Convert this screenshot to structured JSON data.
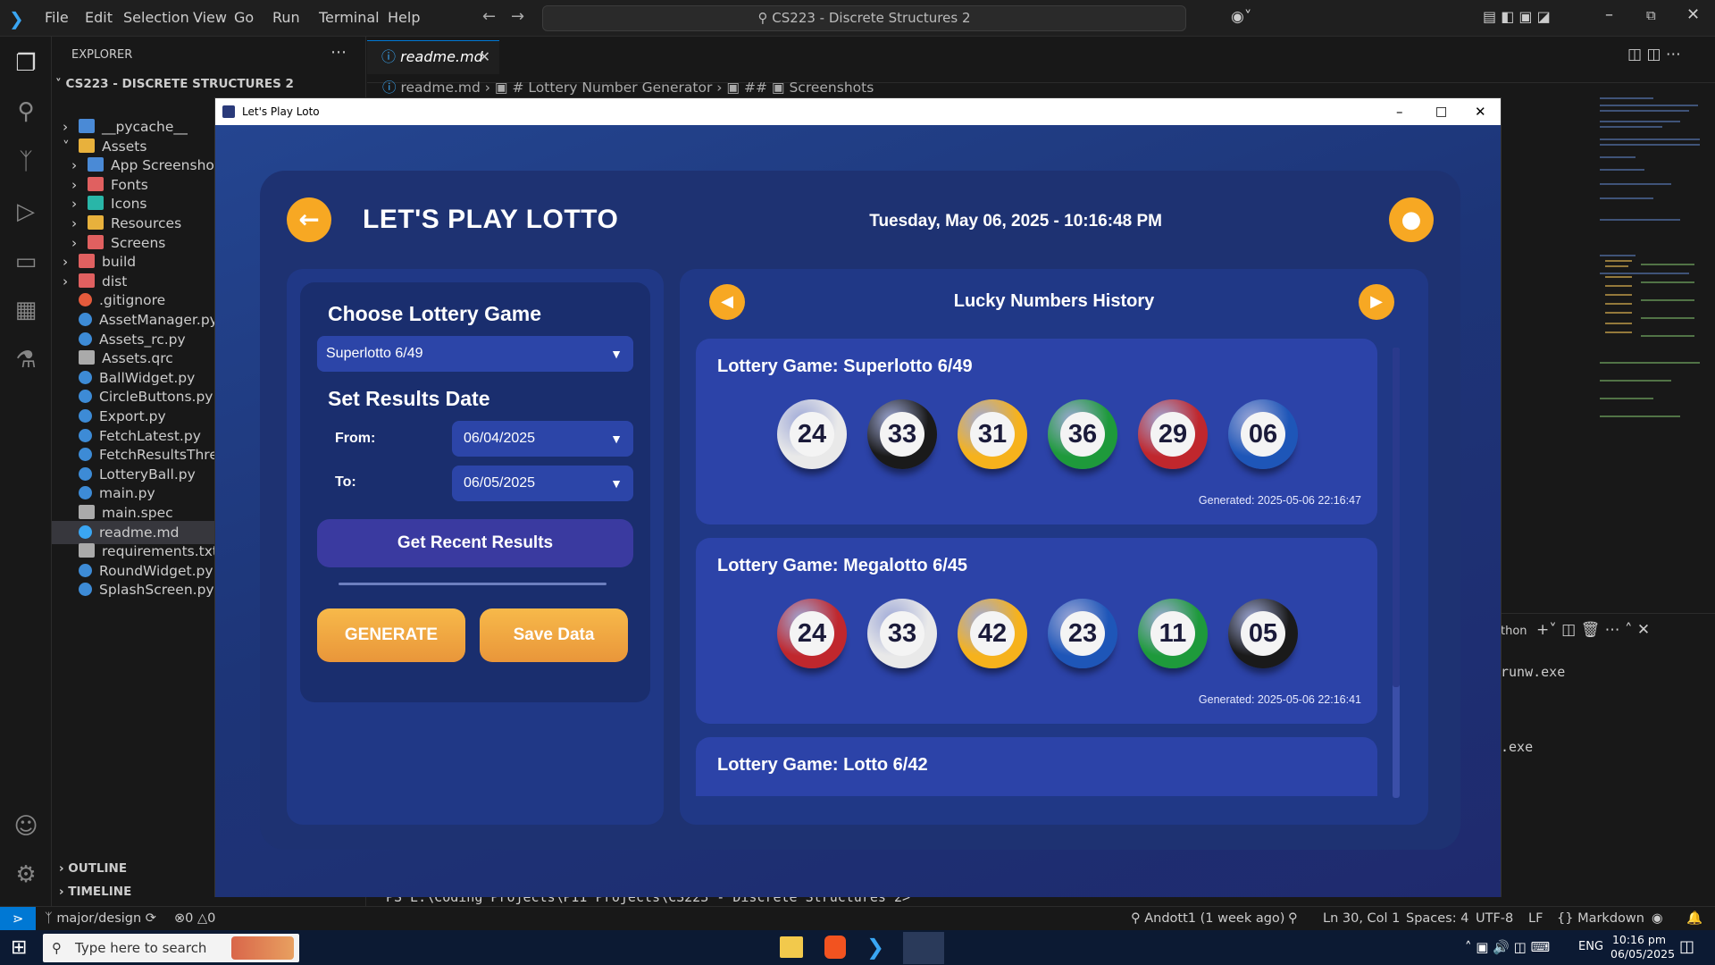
{
  "vscode": {
    "menu": [
      "File",
      "Edit",
      "Selection",
      "View",
      "Go",
      "Run",
      "Terminal",
      "Help"
    ],
    "command_center": "CS223 - Discrete Structures 2",
    "explorer_title": "EXPLORER",
    "workspace": "CS223 - DISCRETE STRUCTURES 2",
    "tree": [
      {
        "label": "__pycache__",
        "indent": 1,
        "kind": "folder"
      },
      {
        "label": "Assets",
        "indent": 1,
        "kind": "folder-open"
      },
      {
        "label": "App Screenshots",
        "indent": 2,
        "kind": "folder"
      },
      {
        "label": "Fonts",
        "indent": 2,
        "kind": "folder-red"
      },
      {
        "label": "Icons",
        "indent": 2,
        "kind": "folder-teal"
      },
      {
        "label": "Resources",
        "indent": 2,
        "kind": "folder-yellow"
      },
      {
        "label": "Screens",
        "indent": 2,
        "kind": "folder-red"
      },
      {
        "label": "build",
        "indent": 1,
        "kind": "folder-red"
      },
      {
        "label": "dist",
        "indent": 1,
        "kind": "folder-red"
      },
      {
        "label": ".gitignore",
        "indent": 1,
        "kind": "git"
      },
      {
        "label": "AssetManager.py",
        "indent": 1,
        "kind": "py"
      },
      {
        "label": "Assets_rc.py",
        "indent": 1,
        "kind": "py"
      },
      {
        "label": "Assets.qrc",
        "indent": 1,
        "kind": "file"
      },
      {
        "label": "BallWidget.py",
        "indent": 1,
        "kind": "py"
      },
      {
        "label": "CircleButtons.py",
        "indent": 1,
        "kind": "py"
      },
      {
        "label": "Export.py",
        "indent": 1,
        "kind": "py"
      },
      {
        "label": "FetchLatest.py",
        "indent": 1,
        "kind": "py"
      },
      {
        "label": "FetchResultsThre",
        "indent": 1,
        "kind": "py"
      },
      {
        "label": "LotteryBall.py",
        "indent": 1,
        "kind": "py"
      },
      {
        "label": "main.py",
        "indent": 1,
        "kind": "py"
      },
      {
        "label": "main.spec",
        "indent": 1,
        "kind": "file"
      },
      {
        "label": "readme.md",
        "indent": 1,
        "kind": "info"
      },
      {
        "label": "requirements.txt",
        "indent": 1,
        "kind": "file"
      },
      {
        "label": "RoundWidget.py",
        "indent": 1,
        "kind": "py"
      },
      {
        "label": "SplashScreen.py",
        "indent": 1,
        "kind": "py"
      }
    ],
    "outline": "OUTLINE",
    "timeline": "TIMELINE",
    "tab": "readme.md",
    "breadcrumb": [
      "readme.md",
      "# Lottery Number Generator",
      "##",
      "Screenshots"
    ],
    "terminal": {
      "header": "thon",
      "lines": [
        "runw.exe",
        ".exe"
      ],
      "prompt": "PS E:\\Coding Projects\\PII Projects\\CS223 - Discrete Structures 2> "
    },
    "status": {
      "branch": "major/design",
      "errors": "0",
      "warnings": "0",
      "blame": "Andott1 (1 week ago)",
      "position": "Ln 30, Col 1",
      "spaces": "Spaces: 4",
      "encoding": "UTF-8",
      "eol": "LF",
      "language": "Markdown"
    }
  },
  "taskbar": {
    "search": "Type here to search",
    "lang": "ENG",
    "time": "10:16 pm",
    "date": "06/05/2025"
  },
  "app": {
    "window_title": "Let's Play Loto",
    "heading": "LET'S PLAY LOTTO",
    "datetime": "Tuesday, May 06, 2025 - 10:16:48 PM",
    "choose_label": "Choose Lottery Game",
    "game_selected": "Superlotto 6/49",
    "set_date_label": "Set Results Date",
    "from_label": "From:",
    "from_value": "06/04/2025",
    "to_label": "To:",
    "to_value": "06/05/2025",
    "recent_button": "Get Recent Results",
    "generate_button": "GENERATE",
    "save_button": "Save Data",
    "history_title": "Lucky Numbers History",
    "history": [
      {
        "title": "Lottery Game: Superlotto 6/49",
        "numbers": [
          "24",
          "33",
          "31",
          "36",
          "29",
          "06"
        ],
        "colors": [
          "#e9e9e9",
          "#1a1a1a",
          "#f6b21c",
          "#1e9a3b",
          "#c0272d",
          "#1e56b8"
        ],
        "generated": "Generated: 2025-05-06 22:16:47"
      },
      {
        "title": "Lottery Game: Megalotto 6/45",
        "numbers": [
          "24",
          "33",
          "42",
          "23",
          "11",
          "05"
        ],
        "colors": [
          "#c0272d",
          "#e9e9e9",
          "#f6b21c",
          "#1e56b8",
          "#1e9a3b",
          "#1a1a1a"
        ],
        "generated": "Generated: 2025-05-06 22:16:41"
      },
      {
        "title": "Lottery Game: Lotto 6/42",
        "numbers": [],
        "colors": [],
        "generated": ""
      }
    ]
  }
}
